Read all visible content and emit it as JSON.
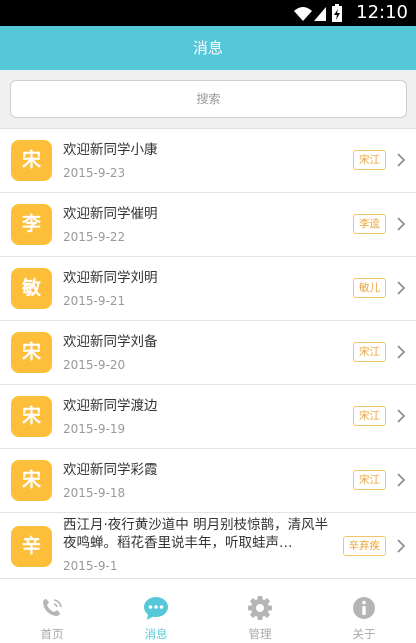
{
  "status_bar": {
    "time": "12:10"
  },
  "header": {
    "title": "消息"
  },
  "search": {
    "placeholder": "搜索"
  },
  "messages": [
    {
      "avatar": "宋",
      "text": "欢迎新同学小康",
      "date": "2015-9-23",
      "tag": "宋江"
    },
    {
      "avatar": "李",
      "text": "欢迎新同学催明",
      "date": "2015-9-22",
      "tag": "李逵"
    },
    {
      "avatar": "敏",
      "text": "欢迎新同学刘明",
      "date": "2015-9-21",
      "tag": "敏儿"
    },
    {
      "avatar": "宋",
      "text": "欢迎新同学刘备",
      "date": "2015-9-20",
      "tag": "宋江"
    },
    {
      "avatar": "宋",
      "text": "欢迎新同学渡边",
      "date": "2015-9-19",
      "tag": "宋江"
    },
    {
      "avatar": "宋",
      "text": "欢迎新同学彩霞",
      "date": "2015-9-18",
      "tag": "宋江"
    },
    {
      "avatar": "辛",
      "text": "西江月·夜行黄沙道中 明月别枝惊鹊，清风半夜鸣蝉。稻花香里说丰年，听取蛙声…",
      "date": "2015-9-1",
      "tag": "辛弃疾"
    }
  ],
  "tabs": [
    {
      "label": "首页",
      "icon": "phone-icon",
      "active": false
    },
    {
      "label": "消息",
      "icon": "chat-bubble-icon",
      "active": true
    },
    {
      "label": "管理",
      "icon": "gear-icon",
      "active": false
    },
    {
      "label": "关于",
      "icon": "info-icon",
      "active": false
    }
  ],
  "colors": {
    "header_bg": "#54c8d9",
    "avatar_bg": "#fdbf3a",
    "tag_border": "#f6c36b",
    "tag_text": "#e8a53b",
    "tab_active": "#54c8d9",
    "tab_inactive": "#a9a9a9"
  }
}
